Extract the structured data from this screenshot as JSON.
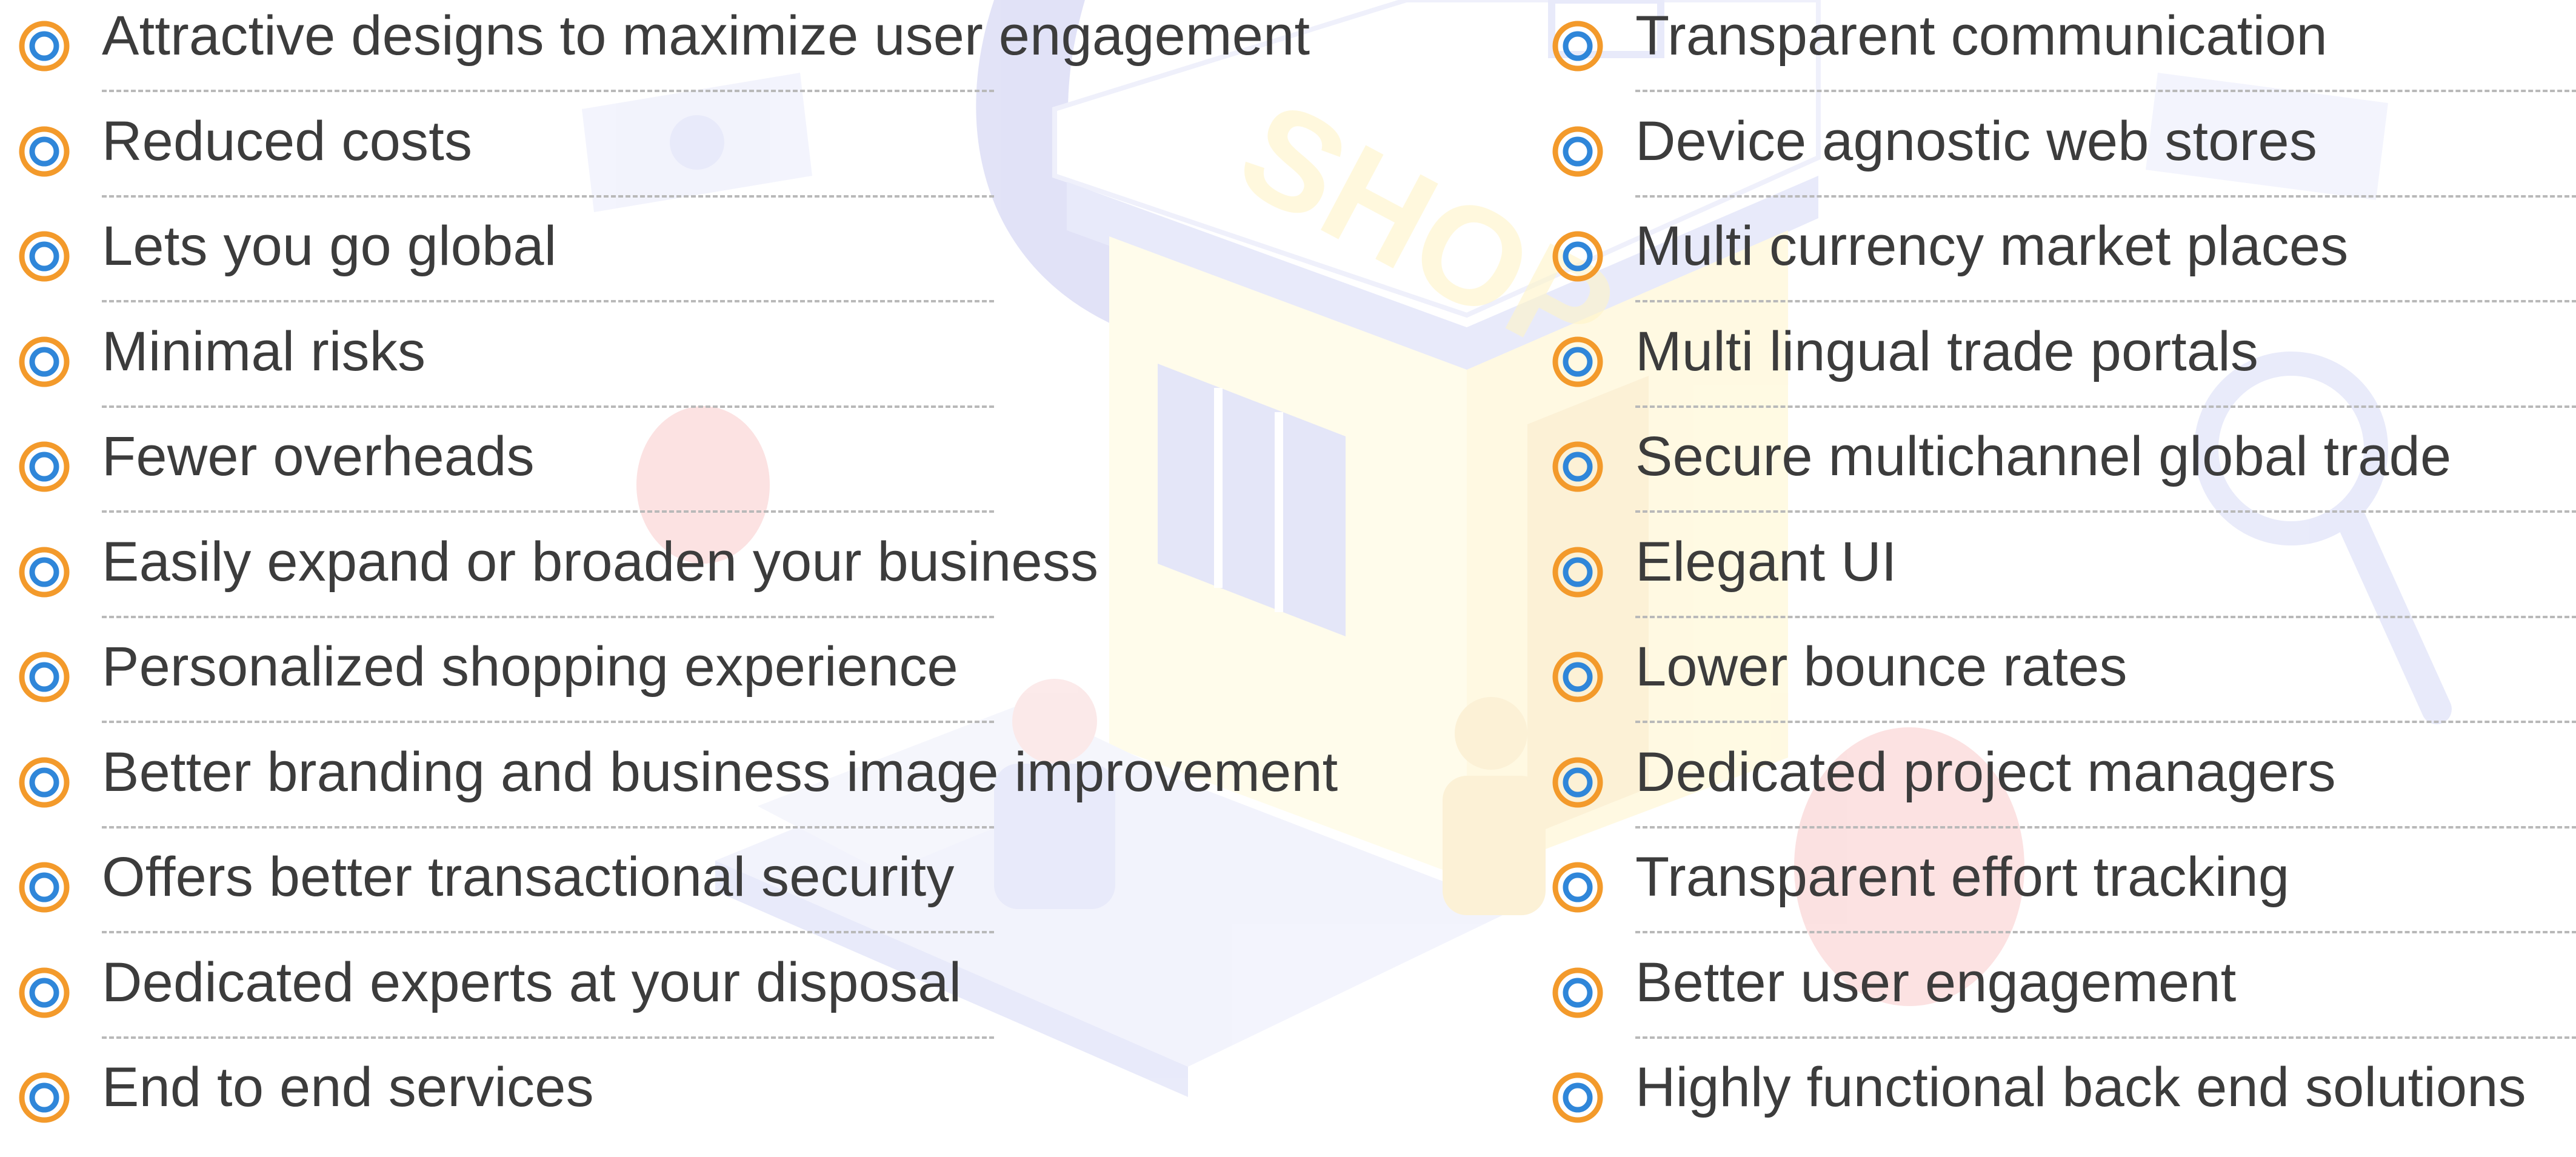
{
  "colors": {
    "text": "#3c3c3c",
    "bullet_outer": "#f39a2b",
    "bullet_inner": "#2f86d9",
    "divider": "#b9b9b9",
    "background": "#ffffff"
  },
  "bullet_icon": "orange-blue-ring-icon",
  "left_column": {
    "items": [
      {
        "label": "Attractive designs to maximize user engagement"
      },
      {
        "label": "Reduced costs"
      },
      {
        "label": "Lets you go global"
      },
      {
        "label": "Minimal risks"
      },
      {
        "label": "Fewer overheads"
      },
      {
        "label": "Easily expand or broaden your business"
      },
      {
        "label": "Personalized shopping experience"
      },
      {
        "label": "Better branding and business image improvement"
      },
      {
        "label": "Offers better transactional security"
      },
      {
        "label": "Dedicated experts at your disposal"
      },
      {
        "label": "End to end services"
      }
    ]
  },
  "right_column": {
    "items": [
      {
        "label": "Transparent communication"
      },
      {
        "label": "Device agnostic web stores"
      },
      {
        "label": "Multi currency market places"
      },
      {
        "label": "Multi lingual trade portals"
      },
      {
        "label": "Secure multichannel global trade"
      },
      {
        "label": "Elegant UI"
      },
      {
        "label": "Lower bounce rates"
      },
      {
        "label": "Dedicated project managers"
      },
      {
        "label": "Transparent effort tracking"
      },
      {
        "label": "Better user engagement"
      },
      {
        "label": "Highly functional back end solutions"
      }
    ]
  },
  "background_illustration": {
    "sign_text": "SHOP"
  }
}
